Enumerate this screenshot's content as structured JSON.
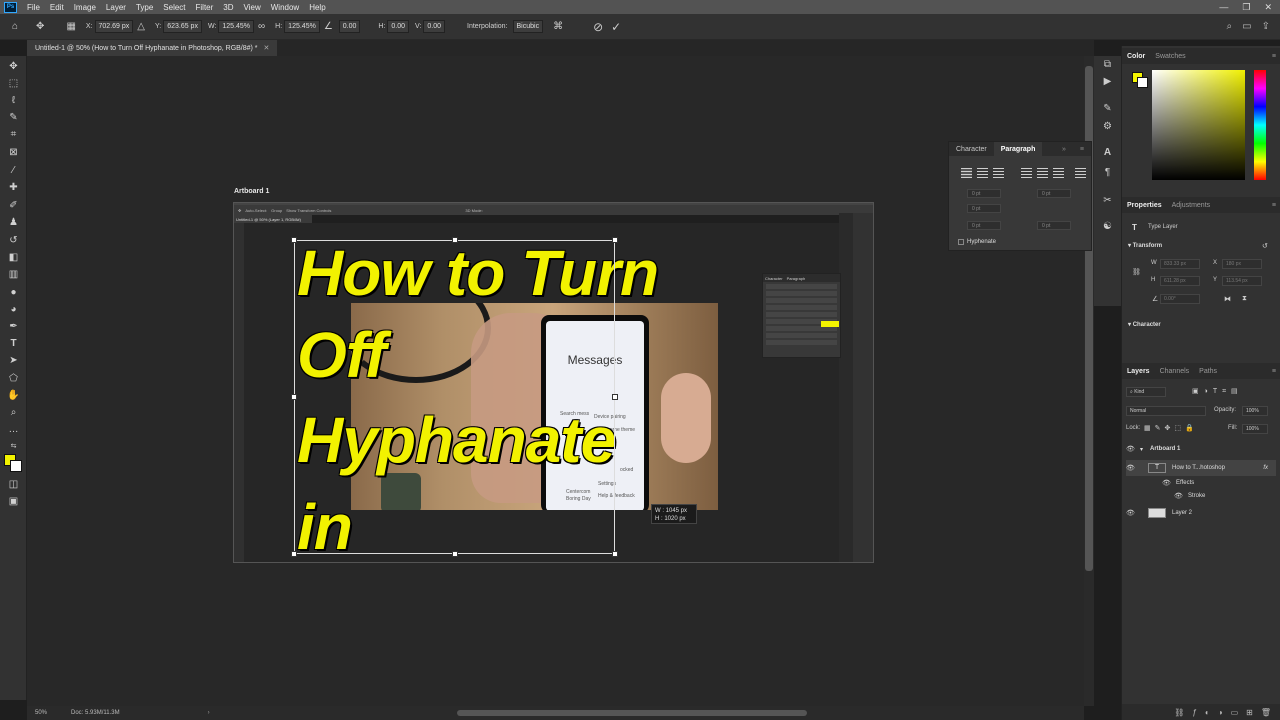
{
  "menubar": {
    "logo": "Ps",
    "items": [
      "File",
      "Edit",
      "Image",
      "Layer",
      "Type",
      "Select",
      "Filter",
      "3D",
      "View",
      "Window",
      "Help"
    ],
    "window_buttons": [
      "—",
      "❐",
      "✕"
    ]
  },
  "options": {
    "x_label": "X:",
    "x_value": "702.69 px",
    "y_label": "Y:",
    "y_value": "623.65 px",
    "w_label": "W:",
    "w_value": "125.45%",
    "h_label": "H:",
    "h_value": "125.45%",
    "angle_value": "0.00",
    "hskew_label": "H:",
    "hskew_value": "0.00",
    "vskew_label": "V:",
    "vskew_value": "0.00",
    "interp_label": "Interpolation:",
    "interp_value": "Bicubic"
  },
  "document": {
    "tab_title": "Untitled-1 @ 50% (How to Turn Off Hyphanate in  Photoshop, RGB/8#) *",
    "artboard_label": "Artboard 1",
    "headline": [
      "How to Turn",
      "Off",
      "Hyphanate",
      "in"
    ],
    "phone_screen_title": "Messages",
    "phone_lines": [
      "Search mess",
      "Device pairing",
      "ame theme",
      "d",
      "ocked",
      "Settings",
      "Centercom",
      "Boring Day",
      "Help & feedback",
      "Help & feedback"
    ],
    "dim_w": "W :   1045 px",
    "dim_h": "H :   1020 px"
  },
  "nested_screenshot": {
    "tab": "Untitled-1 @ 50% (Layer 1, RGB/8#)",
    "opts": [
      "Auto-Select:",
      "Group",
      "Show Transform Controls",
      "3D Mode:"
    ],
    "panel_tabs": [
      "Character",
      "Paragraph"
    ],
    "highlight_color": "#f4f400"
  },
  "status": {
    "zoom": "50%",
    "doc": "Doc: 5.93M/11.3M",
    "arrow": "›"
  },
  "paragraph_panel": {
    "tabs": [
      "Character",
      "Paragraph"
    ],
    "field_value": "0 pt",
    "hyphenate_label": "Hyphenate"
  },
  "color_panel": {
    "tabs": [
      "Color",
      "Swatches"
    ],
    "foreground": "#f4f400",
    "background": "#ffffff"
  },
  "properties_panel": {
    "tabs": [
      "Properties",
      "Adjustments"
    ],
    "type_layer_label": "Type Layer",
    "transform_label": "Transform",
    "w_label": "W",
    "w_value": "833.33 px",
    "x_label": "X",
    "x_value": "180 px",
    "h_label": "H",
    "h_value": "611.28 px",
    "y_label": "Y",
    "y_value": "113.54 px",
    "angle_value": "0.00°",
    "character_label": "Character"
  },
  "layers_panel": {
    "tabs": [
      "Layers",
      "Channels",
      "Paths"
    ],
    "filter_label": "Kind",
    "blend_mode": "Normal",
    "opacity_label": "Opacity:",
    "opacity_value": "100%",
    "lock_label": "Lock:",
    "fill_label": "Fill:",
    "fill_value": "100%",
    "layers": [
      {
        "name": "Artboard 1",
        "kind": "artboard"
      },
      {
        "name": "How to T...hotoshop",
        "kind": "text",
        "fx": "fx"
      },
      {
        "name": "Effects",
        "kind": "effects"
      },
      {
        "name": "Stroke",
        "kind": "effect"
      },
      {
        "name": "Layer 2",
        "kind": "image"
      }
    ]
  }
}
